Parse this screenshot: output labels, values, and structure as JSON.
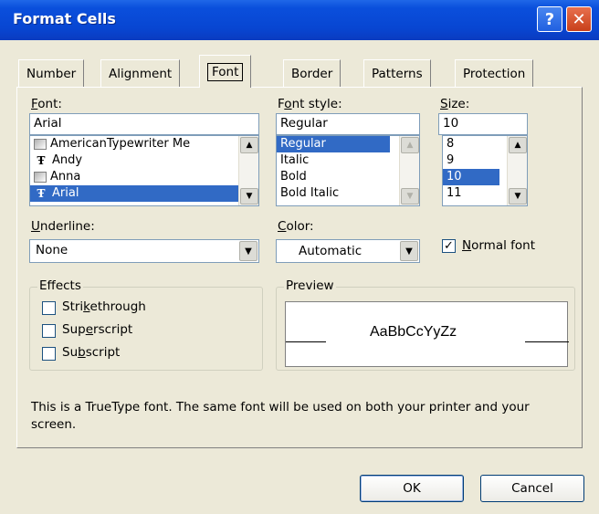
{
  "window": {
    "title": "Format Cells",
    "help_glyph": "?",
    "close_glyph": "✕"
  },
  "tabs": [
    {
      "label": "Number",
      "active": false
    },
    {
      "label": "Alignment",
      "active": false
    },
    {
      "label": "Font",
      "active": true
    },
    {
      "label": "Border",
      "active": false
    },
    {
      "label": "Patterns",
      "active": false
    },
    {
      "label": "Protection",
      "active": false
    }
  ],
  "font": {
    "label_mnemonic": "F",
    "label_rest": "ont:",
    "value": "Arial",
    "list": [
      {
        "name": "AmericanTypewriter Me",
        "icon": "printer-font-icon",
        "selected": false
      },
      {
        "name": "Andy",
        "icon": "truetype-icon",
        "selected": false
      },
      {
        "name": "Anna",
        "icon": "printer-font-icon",
        "selected": false
      },
      {
        "name": "Arial",
        "icon": "truetype-icon",
        "selected": true
      }
    ]
  },
  "font_style": {
    "label_pre": "F",
    "label_mnemonic": "o",
    "label_rest": "nt style:",
    "value": "Regular",
    "list": [
      {
        "name": "Regular",
        "selected": true
      },
      {
        "name": "Italic",
        "selected": false
      },
      {
        "name": "Bold",
        "selected": false
      },
      {
        "name": "Bold Italic",
        "selected": false
      }
    ]
  },
  "size": {
    "label_mnemonic": "S",
    "label_rest": "ize:",
    "value": "10",
    "list": [
      {
        "name": "8",
        "selected": false
      },
      {
        "name": "9",
        "selected": false
      },
      {
        "name": "10",
        "selected": true
      },
      {
        "name": "11",
        "selected": false
      }
    ]
  },
  "underline": {
    "label_mnemonic": "U",
    "label_rest": "nderline:",
    "value": "None"
  },
  "color": {
    "label_mnemonic": "C",
    "label_rest": "olor:",
    "value": "Automatic"
  },
  "normal_font": {
    "label_mnemonic": "N",
    "label_rest": "ormal font",
    "checked": true,
    "check_glyph": "✓"
  },
  "effects": {
    "title": "Effects",
    "items": [
      {
        "pre": "Stri",
        "mnemonic": "k",
        "rest": "ethrough",
        "checked": false
      },
      {
        "pre": "Sup",
        "mnemonic": "e",
        "rest": "rscript",
        "checked": false
      },
      {
        "pre": "Su",
        "mnemonic": "b",
        "rest": "script",
        "checked": false
      }
    ]
  },
  "preview": {
    "title": "Preview",
    "sample": "AaBbCcYyZz"
  },
  "description": "This is a TrueType font.  The same font will be used on both your printer and your screen.",
  "buttons": {
    "ok": "OK",
    "cancel": "Cancel"
  },
  "scroll_glyphs": {
    "up": "▲",
    "down": "▼"
  },
  "colors": {
    "titlebar": "#0a4fdc",
    "selection": "#316ac5",
    "dialog_bg": "#ece9d8"
  }
}
